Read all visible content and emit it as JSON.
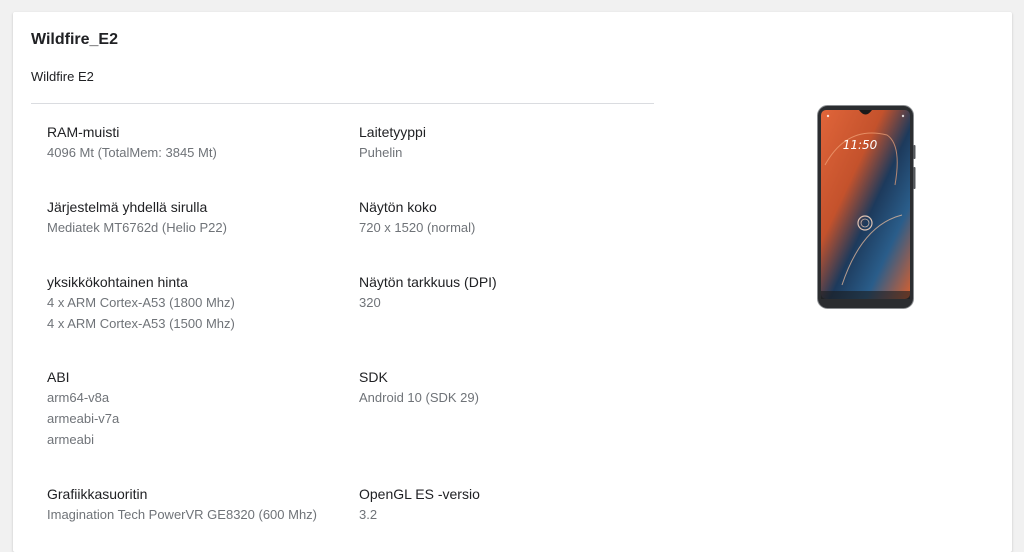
{
  "device": {
    "title": "Wildfire_E2",
    "model": "Wildfire E2"
  },
  "phone_image": {
    "lock_time": "11:50",
    "icon": "phone-image"
  },
  "specs": {
    "ram": {
      "label": "RAM-muisti",
      "value": "4096 Mt (TotalMem: 3845 Mt)"
    },
    "device_type": {
      "label": "Laitetyyppi",
      "value": "Puhelin"
    },
    "soc": {
      "label": "Järjestelmä yhdellä sirulla",
      "value": "Mediatek MT6762d (Helio P22)"
    },
    "screen_size": {
      "label": "Näytön koko",
      "value": "720 x 1520 (normal)"
    },
    "cpu": {
      "label": "yksikkökohtainen hinta",
      "values": [
        "4 x ARM Cortex-A53 (1800 Mhz)",
        "4 x ARM Cortex-A53 (1500 Mhz)"
      ]
    },
    "dpi": {
      "label": "Näytön tarkkuus (DPI)",
      "value": "320"
    },
    "abi": {
      "label": "ABI",
      "values": [
        "arm64-v8a",
        "armeabi-v7a",
        "armeabi"
      ]
    },
    "sdk": {
      "label": "SDK",
      "value": "Android 10 (SDK 29)"
    },
    "gpu": {
      "label": "Grafiikkasuoritin",
      "value": "Imagination Tech PowerVR GE8320 (600 Mhz)"
    },
    "opengl": {
      "label": "OpenGL ES -versio",
      "value": "3.2"
    }
  }
}
